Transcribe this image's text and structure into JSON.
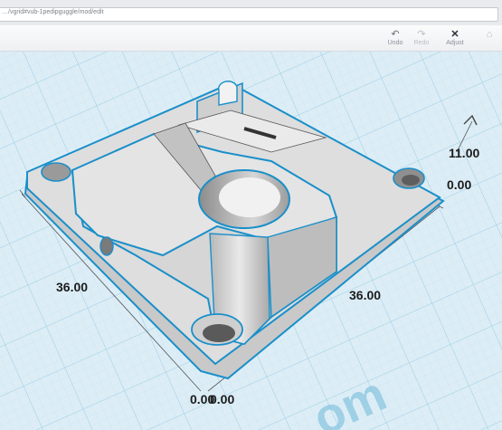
{
  "address_bar": {
    "url": "…/vgrid#vub-1pedipguggle/mod/edit"
  },
  "toolbar": {
    "undo_label": "Undo",
    "redo_label": "Redo",
    "adjust_label": "Adjust"
  },
  "dimensions": {
    "height_value": "11.00",
    "elevation_value": "0.00",
    "length_value": "36.00",
    "width_value": "36.00",
    "origin_x_value": "0.00",
    "origin_y_value": "0.00"
  },
  "watermark_text": "om",
  "colors": {
    "selection_outline": "#1a8fc9",
    "model_face": "#dcdcdc",
    "grid_line": "#b9dcec",
    "workplane": "#dcedf6"
  },
  "icons": [
    "undo-icon",
    "redo-icon",
    "adjust-icon",
    "rotate-arrow-icon"
  ]
}
